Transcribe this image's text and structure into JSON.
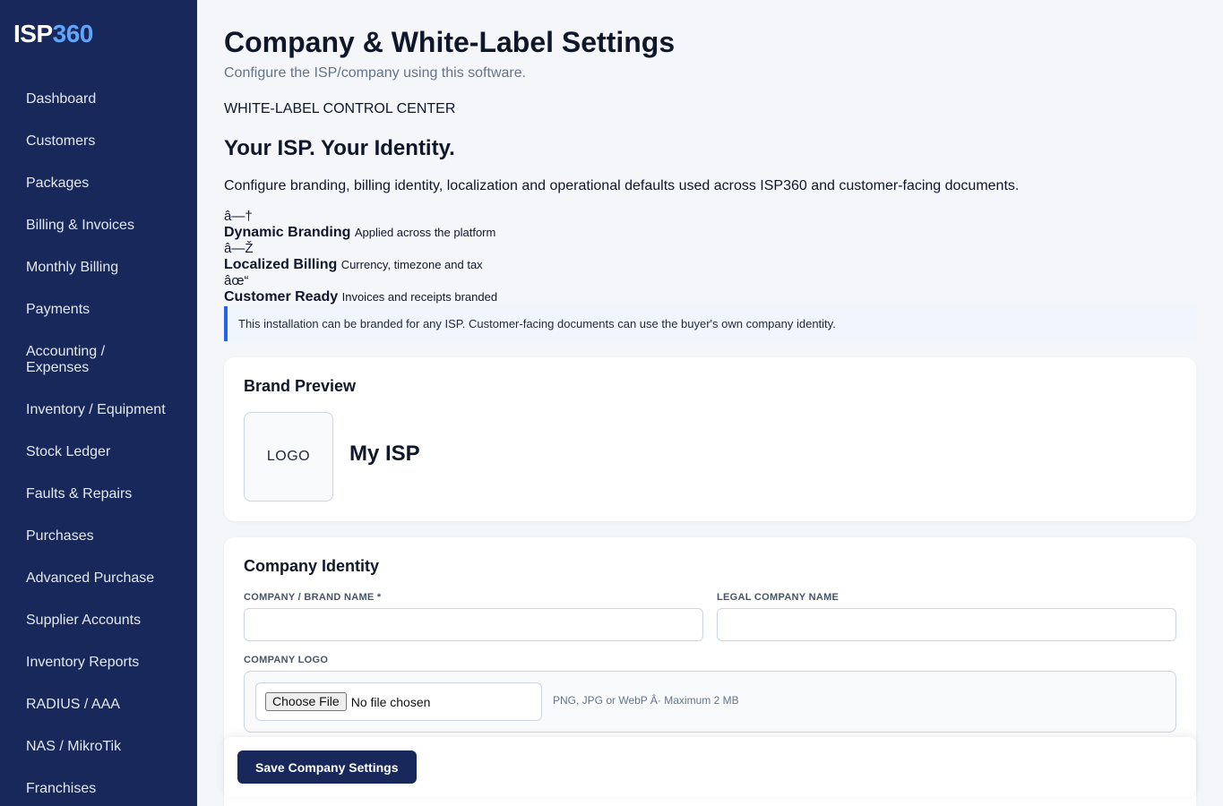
{
  "app": {
    "brand_main": "ISP",
    "brand_accent": "360"
  },
  "sidebar": {
    "items": [
      {
        "label": "Dashboard"
      },
      {
        "label": "Customers"
      },
      {
        "label": "Packages"
      },
      {
        "label": "Billing & Invoices"
      },
      {
        "label": "Monthly Billing"
      },
      {
        "label": "Payments"
      },
      {
        "label": "Accounting / Expenses"
      },
      {
        "label": "Inventory / Equipment"
      },
      {
        "label": "Stock Ledger"
      },
      {
        "label": "Faults & Repairs"
      },
      {
        "label": "Purchases"
      },
      {
        "label": "Advanced Purchase"
      },
      {
        "label": "Supplier Accounts"
      },
      {
        "label": "Inventory Reports"
      },
      {
        "label": "RADIUS / AAA"
      },
      {
        "label": "NAS / MikroTik"
      },
      {
        "label": "Franchises"
      }
    ]
  },
  "header": {
    "title": "Company & White-Label Settings",
    "subtitle": "Configure the ISP/company using this software."
  },
  "hero": {
    "eyebrow": "WHITE-LABEL CONTROL CENTER",
    "title": "Your ISP. Your Identity.",
    "description": "Configure branding, billing identity, localization and operational defaults used across ISP360 and customer-facing documents."
  },
  "features": [
    {
      "glyph": "â—†",
      "title": "Dynamic Branding",
      "desc": "Applied across the platform"
    },
    {
      "glyph": "â—Ž",
      "title": "Localized Billing",
      "desc": "Currency, timezone and tax"
    },
    {
      "glyph": "âœ“",
      "title": "Customer Ready",
      "desc": "Invoices and receipts branded"
    }
  ],
  "notice": {
    "text": "This installation can be branded for any ISP. Customer-facing documents can use the buyer's own company identity."
  },
  "preview": {
    "title": "Brand Preview",
    "logo_placeholder": "LOGO",
    "company_name": "My ISP"
  },
  "identity": {
    "title": "Company Identity",
    "brand_name_label": "COMPANY / BRAND NAME *",
    "brand_name_value": "",
    "legal_name_label": "LEGAL COMPANY NAME",
    "legal_name_value": "",
    "logo_label": "COMPANY LOGO",
    "choose_file_label": "Choose File",
    "file_status": "No file chosen",
    "file_hint": "PNG, JPG or WebP Â· Maximum 2 MB"
  },
  "actions": {
    "save_label": "Save Company Settings"
  },
  "colors": {
    "sidebar_bg": "#18285a",
    "accent": "#60a5fa",
    "primary": "#2563eb"
  }
}
